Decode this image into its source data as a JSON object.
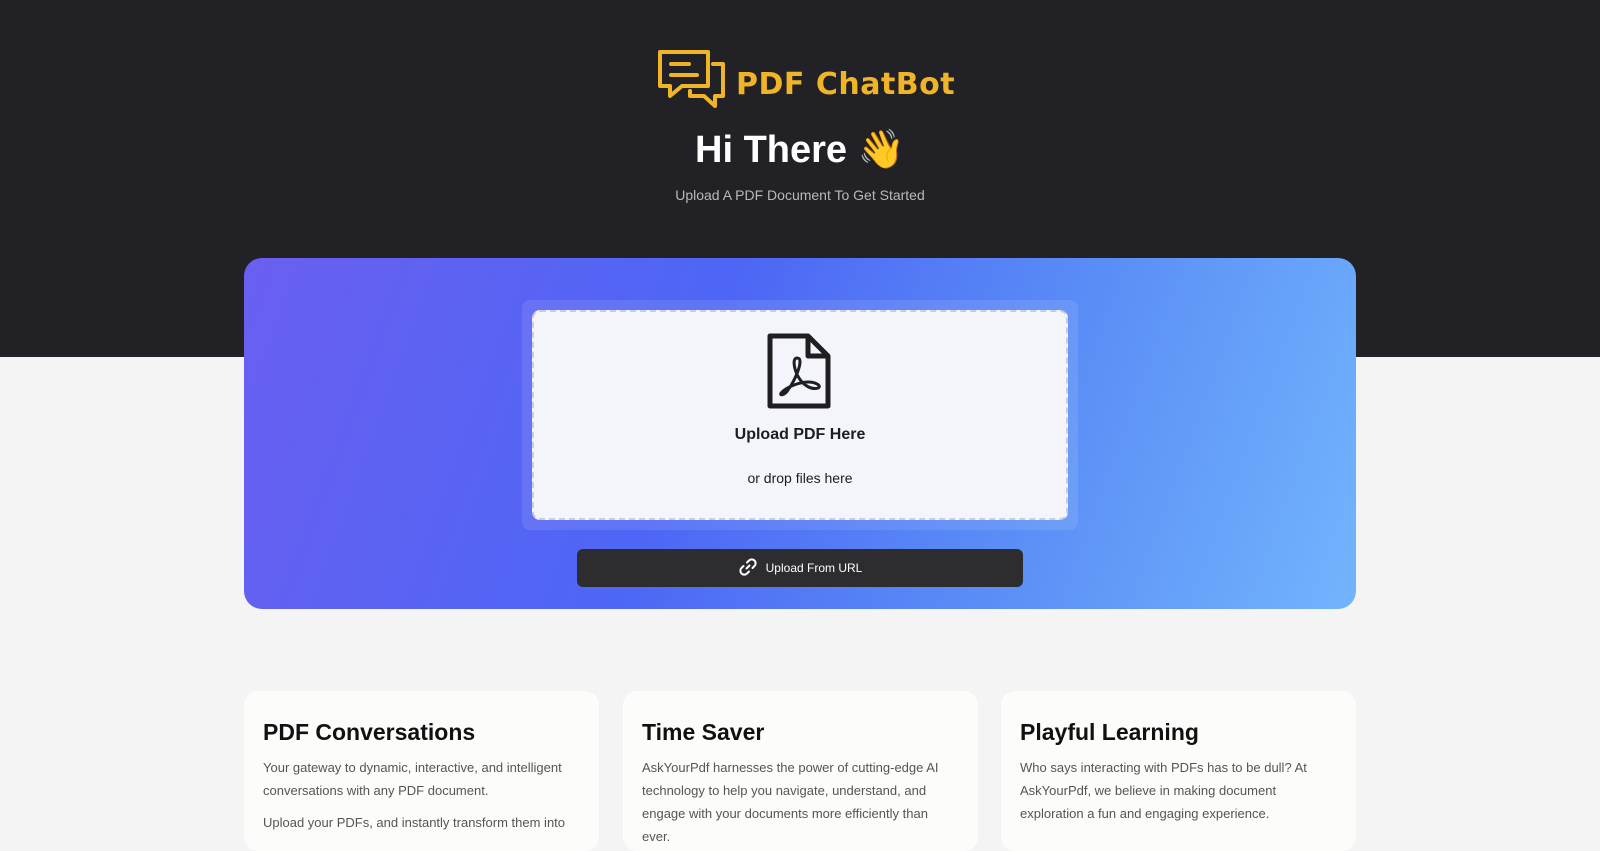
{
  "brand": {
    "name": "PDF ChatBot",
    "logo_icon": "chat-bubbles-icon",
    "color": "#f0b429"
  },
  "hero": {
    "greeting": "Hi There 👋",
    "subtitle": "Upload A PDF Document To Get Started"
  },
  "upload": {
    "icon": "pdf-file-icon",
    "title": "Upload PDF Here",
    "subtitle": "or drop files here",
    "url_button_icon": "link-icon",
    "url_button_label": "Upload From URL"
  },
  "features": [
    {
      "title": "PDF Conversations",
      "paragraphs": [
        "Your gateway to dynamic, interactive, and intelligent conversations with any PDF document.",
        "Upload your PDFs, and instantly transform them into"
      ]
    },
    {
      "title": "Time Saver",
      "paragraphs": [
        "AskYourPdf harnesses the power of cutting-edge AI technology to help you navigate, understand, and engage with your documents more efficiently than ever."
      ]
    },
    {
      "title": "Playful Learning",
      "paragraphs": [
        "Who says interacting with PDFs has to be dull? At AskYourPdf, we believe in making document exploration a fun and engaging experience."
      ]
    }
  ],
  "colors": {
    "header_bg": "#222226",
    "gradient_start": "#6a5ff0",
    "gradient_end": "#72b4fd",
    "button_bg": "#2d2d2f"
  }
}
